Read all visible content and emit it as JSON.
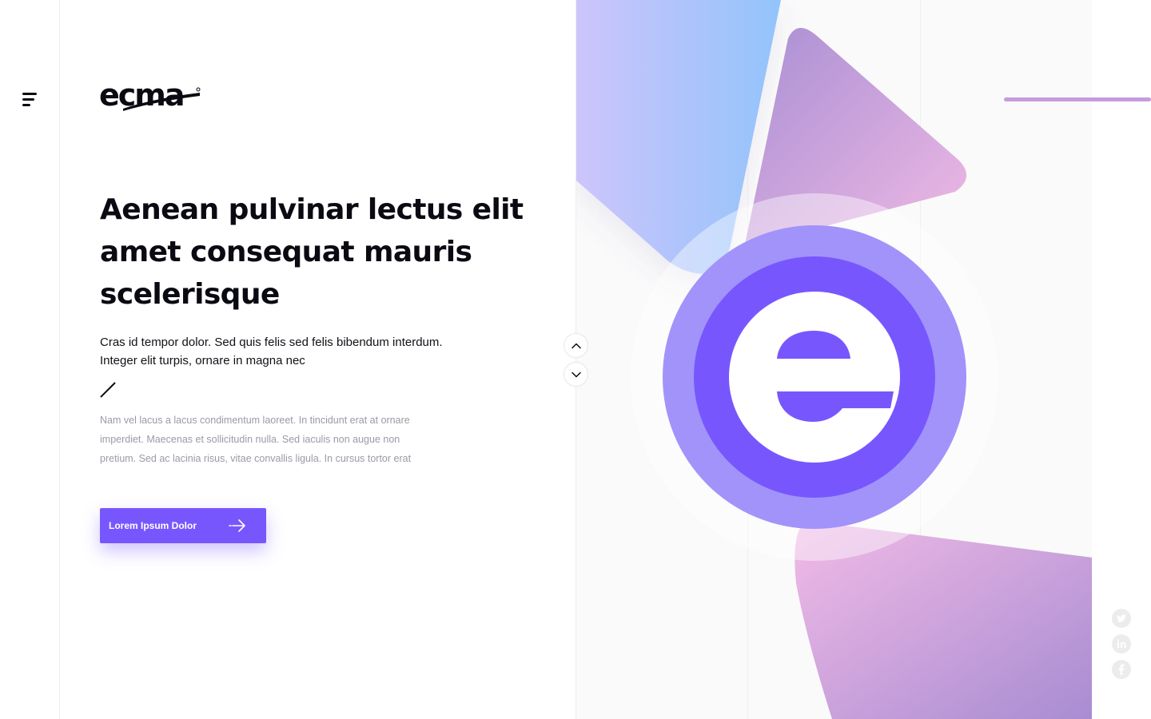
{
  "brand": {
    "logo_text": "ecma"
  },
  "menu": {
    "icon": "hamburger-menu-icon"
  },
  "hero": {
    "headline": "Aenean pulvinar lectus elit amet consequat mauris scelerisque",
    "lead": "Cras id tempor dolor. Sed quis felis sed felis bibendum interdum. Integer elit turpis, ornare in magna nec",
    "body": "Nam vel lacus a lacus condimentum laoreet. In tincidunt erat at ornare imperdiet. Maecenas et sollicitudin nulla. Sed iaculis non augue non pretium. Sed ac lacinia risus, vitae convallis ligula. In cursus tortor erat",
    "cta_label": "Lorem Ipsum Dolor",
    "cta_icon": "arrow-right-icon"
  },
  "scroll": {
    "up_icon": "chevron-up-icon",
    "down_icon": "chevron-down-icon"
  },
  "social": [
    {
      "name": "twitter",
      "icon": "twitter-icon"
    },
    {
      "name": "linkedin",
      "icon": "linkedin-icon"
    },
    {
      "name": "facebook",
      "icon": "facebook-icon"
    }
  ],
  "colors": {
    "primary": "#7757fd",
    "ring": "#a293fb",
    "accent_bar": "#c69bdd",
    "text": "#0a0a12",
    "muted_text": "#9a9aa6"
  }
}
